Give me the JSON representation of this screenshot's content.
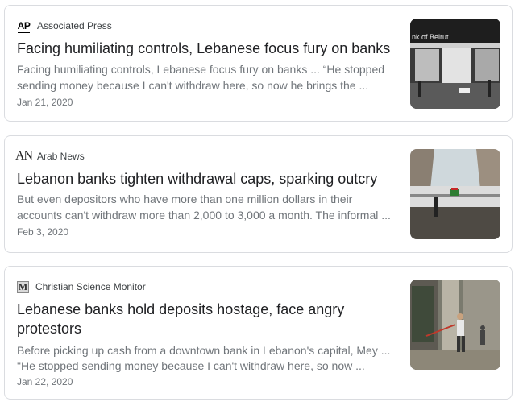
{
  "articles": [
    {
      "source": "Associated Press",
      "logo_text": "AP",
      "title": "Facing humiliating controls, Lebanese focus fury on banks",
      "snippet_line1": "Facing humiliating controls, Lebanese focus fury on banks ... “He stopped",
      "snippet_line2": "sending money because I can't withdraw here, so now he brings the ...",
      "date": "Jan 21, 2020",
      "thumb_sign": "nk of Beirut"
    },
    {
      "source": "Arab News",
      "logo_text": "AN",
      "title": "Lebanon banks tighten withdrawal caps, sparking outcry",
      "snippet_line1": "But even depositors who have more than one million dollars in their",
      "snippet_line2": "accounts can't withdraw more than 2,000 to 3,000 a month. The informal ...",
      "date": "Feb 3, 2020"
    },
    {
      "source": "Christian Science Monitor",
      "logo_text": "M",
      "title_line1": "Lebanese banks hold deposits hostage, face angry",
      "title_line2": "protestors",
      "snippet_line1": "Before picking up cash from a downtown bank in Lebanon's capital, Mey ...",
      "snippet_line2": "\"He stopped sending money because I can't withdraw here, so now ...",
      "date": "Jan 22, 2020"
    }
  ],
  "colors": {
    "title": "#202124",
    "snippet": "#70757a",
    "border": "#dadce0"
  }
}
